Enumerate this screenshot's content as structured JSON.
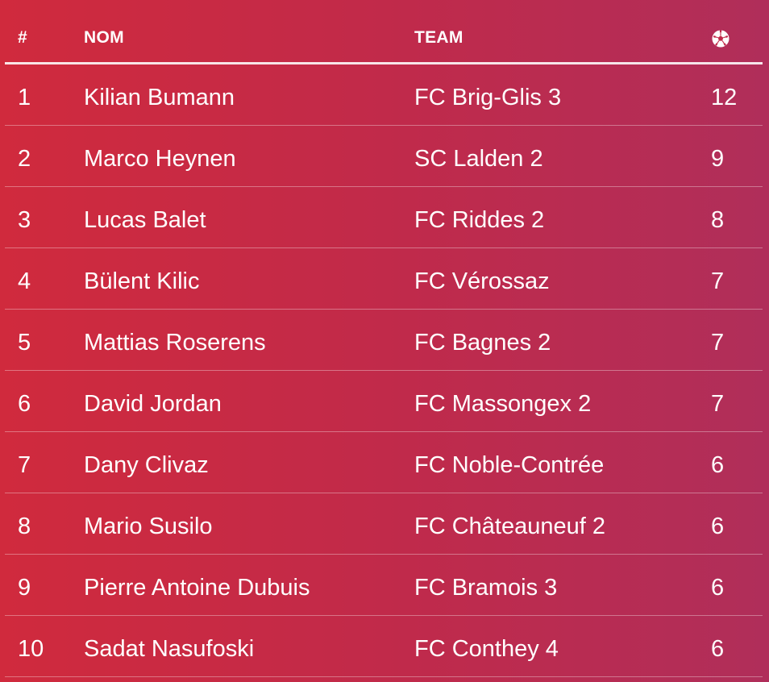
{
  "table": {
    "headers": {
      "rank": "#",
      "name": "NOM",
      "team": "TEAM",
      "goals_icon": "soccer-ball-icon"
    },
    "rows": [
      {
        "rank": "1",
        "name": "Kilian Bumann",
        "team": "FC Brig-Glis 3",
        "goals": "12"
      },
      {
        "rank": "2",
        "name": "Marco Heynen",
        "team": "SC Lalden 2",
        "goals": "9"
      },
      {
        "rank": "3",
        "name": "Lucas Balet",
        "team": "FC Riddes 2",
        "goals": "8"
      },
      {
        "rank": "4",
        "name": "Bülent Kilic",
        "team": "FC Vérossaz",
        "goals": "7"
      },
      {
        "rank": "5",
        "name": "Mattias Roserens",
        "team": "FC Bagnes 2",
        "goals": "7"
      },
      {
        "rank": "6",
        "name": "David Jordan",
        "team": "FC Massongex 2",
        "goals": "7"
      },
      {
        "rank": "7",
        "name": "Dany Clivaz",
        "team": "FC Noble-Contrée",
        "goals": "6"
      },
      {
        "rank": "8",
        "name": "Mario Susilo",
        "team": "FC Châteauneuf 2",
        "goals": "6"
      },
      {
        "rank": "9",
        "name": "Pierre Antoine Dubuis",
        "team": "FC Bramois 3",
        "goals": "6"
      },
      {
        "rank": "10",
        "name": "Sadat Nasufoski",
        "team": "FC Conthey 4",
        "goals": "6"
      }
    ]
  },
  "colors": {
    "background_start": "#d02a3d",
    "background_end": "#b02e5a",
    "text": "#ffffff"
  }
}
